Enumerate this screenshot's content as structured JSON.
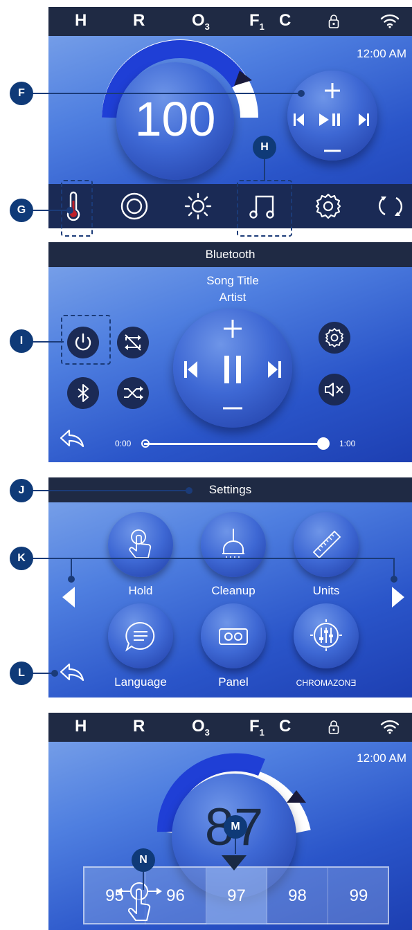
{
  "status_labels": {
    "h": "H",
    "r": "R",
    "o": "O",
    "o_sub": "3",
    "f": "F",
    "f_sub": "1",
    "c": "C"
  },
  "panel1": {
    "clock": "12:00 AM",
    "temperature": "100",
    "gauge_fill_fraction": 0.85
  },
  "panel2": {
    "title": "Bluetooth",
    "song_title": "Song Title",
    "artist": "Artist",
    "time_start": "0:00",
    "time_end": "1:00",
    "progress_fraction": 1.0
  },
  "panel3": {
    "title": "Settings",
    "items": [
      "Hold",
      "Cleanup",
      "Units",
      "Language",
      "Panel",
      "CHROMAZONƎ"
    ]
  },
  "panel4": {
    "clock": "12:00 AM",
    "temperature": "87",
    "gauge_fill_fraction": 0.6,
    "temps": [
      "95",
      "96",
      "97",
      "98",
      "99"
    ],
    "selected": "97"
  },
  "callouts": {
    "f": "F",
    "g": "G",
    "h": "H",
    "i": "I",
    "j": "J",
    "k": "K",
    "l": "L",
    "m": "M",
    "n": "N"
  },
  "colors": {
    "panel_accent": "#2a55c9",
    "bar_dark": "#1f2a44",
    "callout": "#0f3a78",
    "heat_red": "#c0202a"
  }
}
